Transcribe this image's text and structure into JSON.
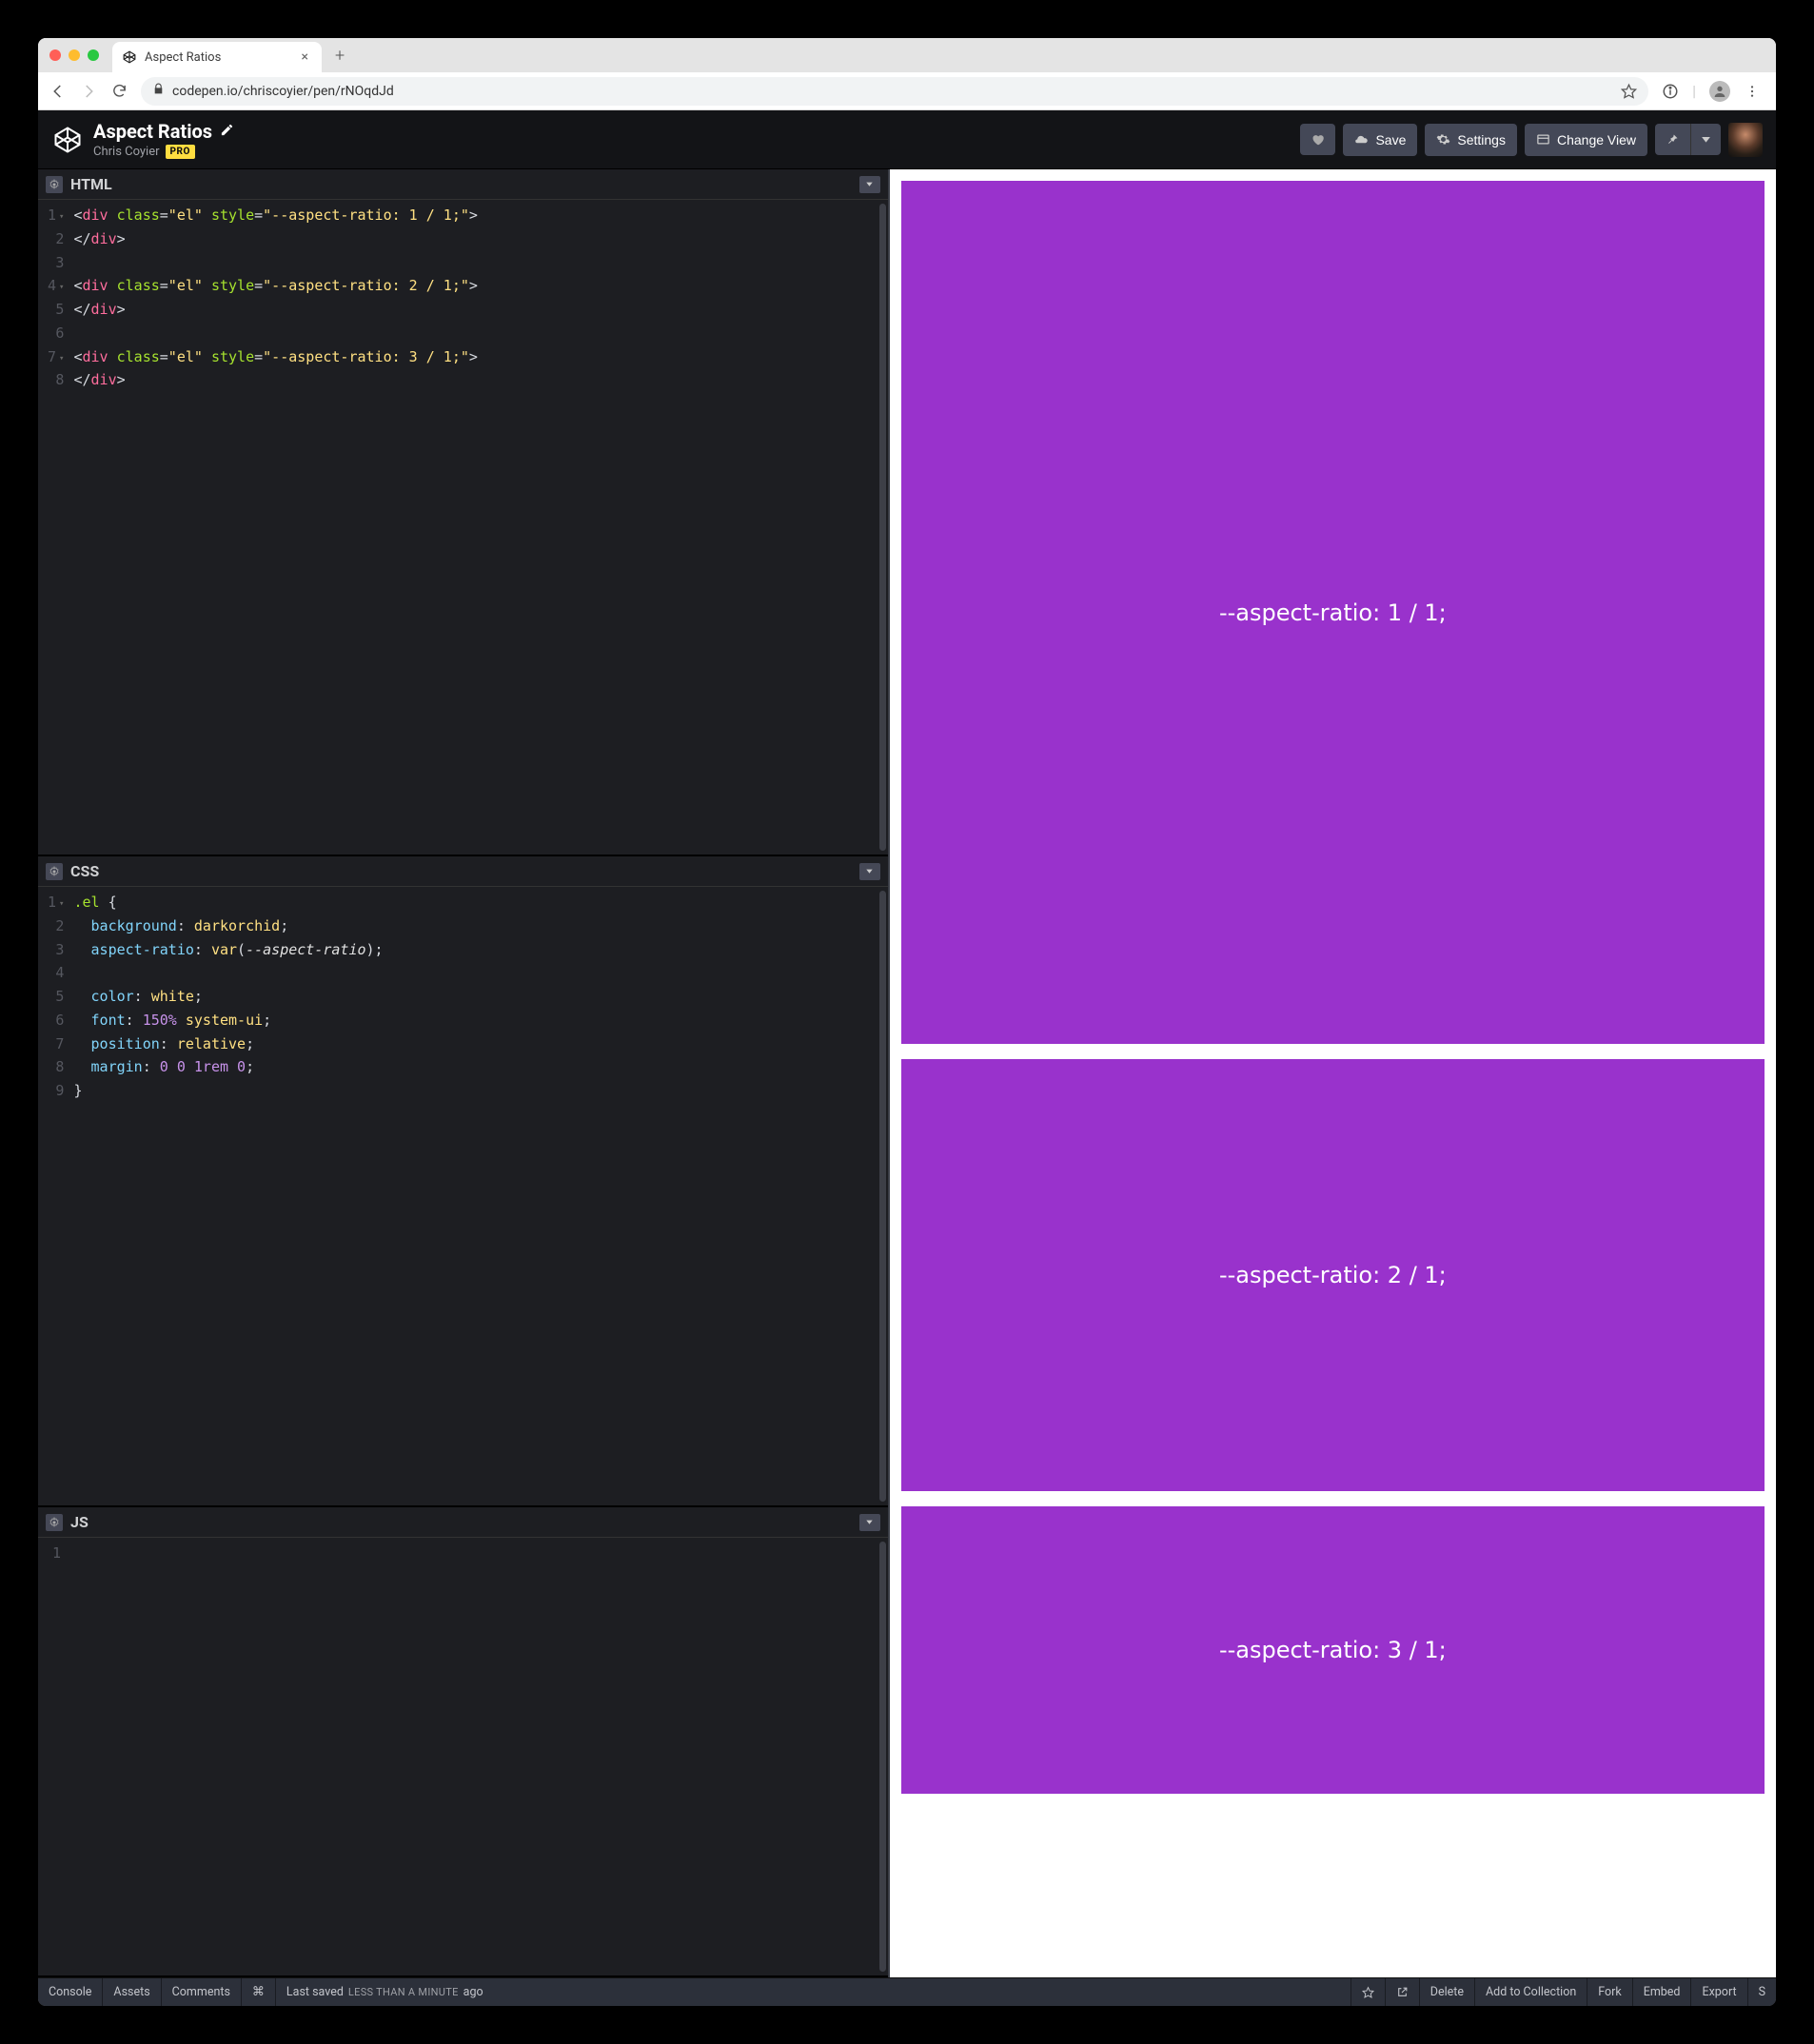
{
  "browser": {
    "tab_title": "Aspect Ratios",
    "url": "codepen.io/chriscoyier/pen/rNOqdJd"
  },
  "header": {
    "title": "Aspect Ratios",
    "author": "Chris Coyier",
    "pro": "PRO",
    "save": "Save",
    "settings": "Settings",
    "change_view": "Change View"
  },
  "panels": {
    "html": {
      "label": "HTML",
      "lines": [
        "1",
        "2",
        "3",
        "4",
        "5",
        "6",
        "7",
        "8"
      ],
      "fold_lines": [
        0,
        3,
        6
      ]
    },
    "css": {
      "label": "CSS",
      "lines": [
        "1",
        "2",
        "3",
        "4",
        "5",
        "6",
        "7",
        "8",
        "9"
      ],
      "fold_lines": [
        0
      ]
    },
    "js": {
      "label": "JS",
      "lines": [
        "1"
      ]
    }
  },
  "code": {
    "html": [
      [
        [
          "p",
          "<"
        ],
        [
          "t",
          "div"
        ],
        [
          "p",
          " "
        ],
        [
          "a",
          "class"
        ],
        [
          "p",
          "="
        ],
        [
          "s",
          "\"el\""
        ],
        [
          "p",
          " "
        ],
        [
          "a",
          "style"
        ],
        [
          "p",
          "="
        ],
        [
          "s",
          "\"--aspect-ratio: 1 / 1;\""
        ],
        [
          "p",
          ">"
        ]
      ],
      [
        [
          "p",
          "</"
        ],
        [
          "t",
          "div"
        ],
        [
          "p",
          ">"
        ]
      ],
      [],
      [
        [
          "p",
          "<"
        ],
        [
          "t",
          "div"
        ],
        [
          "p",
          " "
        ],
        [
          "a",
          "class"
        ],
        [
          "p",
          "="
        ],
        [
          "s",
          "\"el\""
        ],
        [
          "p",
          " "
        ],
        [
          "a",
          "style"
        ],
        [
          "p",
          "="
        ],
        [
          "s",
          "\"--aspect-ratio: 2 / 1;\""
        ],
        [
          "p",
          ">"
        ]
      ],
      [
        [
          "p",
          "</"
        ],
        [
          "t",
          "div"
        ],
        [
          "p",
          ">"
        ]
      ],
      [],
      [
        [
          "p",
          "<"
        ],
        [
          "t",
          "div"
        ],
        [
          "p",
          " "
        ],
        [
          "a",
          "class"
        ],
        [
          "p",
          "="
        ],
        [
          "s",
          "\"el\""
        ],
        [
          "p",
          " "
        ],
        [
          "a",
          "style"
        ],
        [
          "p",
          "="
        ],
        [
          "s",
          "\"--aspect-ratio: 3 / 1;\""
        ],
        [
          "p",
          ">"
        ]
      ],
      [
        [
          "p",
          "</"
        ],
        [
          "t",
          "div"
        ],
        [
          "p",
          ">"
        ]
      ]
    ],
    "css": [
      [
        [
          "sel",
          ".el"
        ],
        [
          "p",
          " {"
        ]
      ],
      [
        [
          "p",
          "  "
        ],
        [
          "prop",
          "background"
        ],
        [
          "p",
          ": "
        ],
        [
          "s",
          "darkorchid"
        ],
        [
          "p",
          ";"
        ]
      ],
      [
        [
          "p",
          "  "
        ],
        [
          "prop",
          "aspect-ratio"
        ],
        [
          "p",
          ": "
        ],
        [
          "s",
          "var"
        ],
        [
          "p",
          "("
        ],
        [
          "var",
          "--aspect-ratio"
        ],
        [
          "p",
          ");"
        ]
      ],
      [],
      [
        [
          "p",
          "  "
        ],
        [
          "prop",
          "color"
        ],
        [
          "p",
          ": "
        ],
        [
          "s",
          "white"
        ],
        [
          "p",
          ";"
        ]
      ],
      [
        [
          "p",
          "  "
        ],
        [
          "prop",
          "font"
        ],
        [
          "p",
          ": "
        ],
        [
          "num",
          "150%"
        ],
        [
          "p",
          " "
        ],
        [
          "s",
          "system-ui"
        ],
        [
          "p",
          ";"
        ]
      ],
      [
        [
          "p",
          "  "
        ],
        [
          "prop",
          "position"
        ],
        [
          "p",
          ": "
        ],
        [
          "s",
          "relative"
        ],
        [
          "p",
          ";"
        ]
      ],
      [
        [
          "p",
          "  "
        ],
        [
          "prop",
          "margin"
        ],
        [
          "p",
          ": "
        ],
        [
          "num",
          "0 0 1rem 0"
        ],
        [
          "p",
          ";"
        ]
      ],
      [
        [
          "p",
          "}"
        ]
      ]
    ]
  },
  "preview": {
    "items": [
      {
        "label": "--aspect-ratio: 1 / 1;",
        "ratio": "1 / 1"
      },
      {
        "label": "--aspect-ratio: 2 / 1;",
        "ratio": "2 / 1"
      },
      {
        "label": "--aspect-ratio: 3 / 1;",
        "ratio": "3 / 1"
      }
    ]
  },
  "footer": {
    "console": "Console",
    "assets": "Assets",
    "comments": "Comments",
    "shortcuts": "⌘",
    "status_prefix": "Last saved",
    "status_rel": "less than a minute",
    "status_suffix": "ago",
    "delete": "Delete",
    "add": "Add to Collection",
    "fork": "Fork",
    "embed": "Embed",
    "export": "Export",
    "share": "S"
  }
}
